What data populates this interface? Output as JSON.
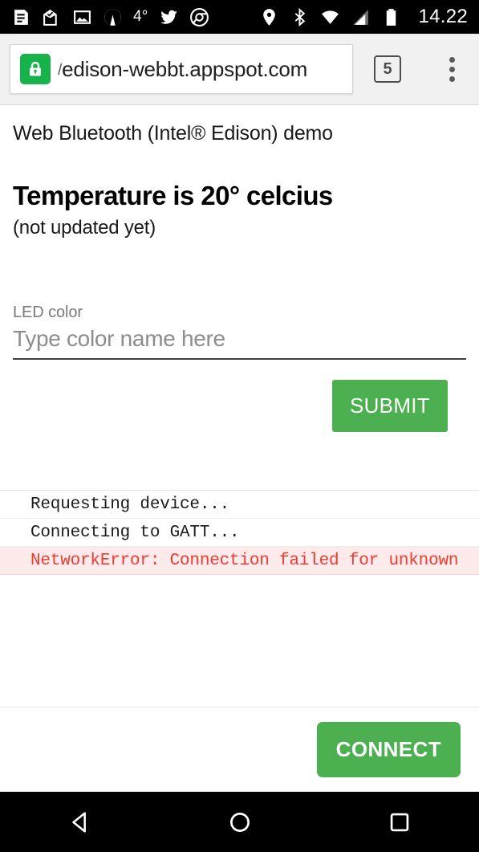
{
  "status_bar": {
    "left_icons": [
      {
        "name": "news-article-icon"
      },
      {
        "name": "mail-open-icon"
      },
      {
        "name": "photo-image-icon"
      },
      {
        "name": "weather-mountain-icon"
      }
    ],
    "temperature": "4°",
    "app_icons": [
      {
        "name": "twitter-icon"
      },
      {
        "name": "chrome-icon"
      }
    ],
    "right_icons": [
      {
        "name": "location-pin-icon"
      },
      {
        "name": "bluetooth-icon"
      },
      {
        "name": "wifi-icon"
      },
      {
        "name": "cell-signal-icon"
      },
      {
        "name": "battery-icon"
      }
    ],
    "clock": "14.22"
  },
  "browser": {
    "security_icon": "lock-icon",
    "url_prefix": "/",
    "url": "edison-webbt.appspot.com",
    "tab_count": "5",
    "menu_icon": "overflow-menu-icon"
  },
  "page": {
    "site_title": "Web Bluetooth (Intel® Edison) demo",
    "temperature_heading": "Temperature is 20° celcius",
    "temperature_status": "(not updated yet)",
    "form": {
      "label": "LED color",
      "placeholder": "Type color name here",
      "value": "",
      "submit_label": "SUBMIT"
    },
    "log": [
      {
        "text": "Requesting device...",
        "level": "info"
      },
      {
        "text": "Connecting to GATT...",
        "level": "info"
      },
      {
        "text": "NetworkError: Connection failed for unknown",
        "level": "error"
      }
    ],
    "connect_label": "CONNECT"
  },
  "nav_bar": {
    "back": "back-triangle-icon",
    "home": "home-circle-icon",
    "recents": "recents-square-icon"
  },
  "colors": {
    "accent_green": "#4caf50",
    "lock_green": "#16b24a",
    "error_red": "#f03c30",
    "error_bg": "#fdeaea"
  }
}
